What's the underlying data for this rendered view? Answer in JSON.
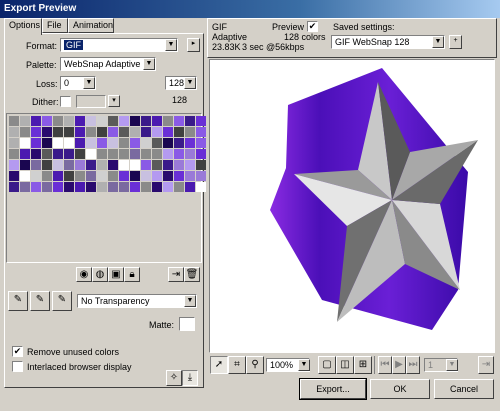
{
  "window": {
    "title": "Export Preview"
  },
  "tabs": [
    {
      "label": "Options"
    },
    {
      "label": "File"
    },
    {
      "label": "Animation"
    }
  ],
  "options": {
    "format_label": "Format:",
    "format_value": "GIF",
    "palette_label": "Palette:",
    "palette_value": "WebSnap Adaptive",
    "loss_label": "Loss:",
    "loss_value": "0",
    "colors_value": "128",
    "colors_count": "128",
    "dither_label": "Dither:",
    "dither_checked": false,
    "transparency_value": "No Transparency",
    "matte_label": "Matte:",
    "remove_unused_label": "Remove unused colors",
    "remove_unused_checked": "✔",
    "interlaced_label": "Interlaced browser display",
    "interlaced_checked": ""
  },
  "preview": {
    "format": "GIF",
    "palette": "Adaptive",
    "filesize": "23.83K",
    "download": "3 sec @56kbps",
    "preview_label": "Preview",
    "preview_checked": "✔",
    "colors_text": "128 colors",
    "saved_settings_label": "Saved settings:",
    "saved_settings_value": "GIF WebSnap 128",
    "zoom_value": "100%",
    "frame_value": "1"
  },
  "buttons": {
    "export": "Export...",
    "ok": "OK",
    "cancel": "Cancel"
  },
  "colors": {
    "purple_dark": "#3a0aa8",
    "purple": "#6a1fd6",
    "star_light": "#e8e8e8",
    "star_dark": "#6a6a6a"
  }
}
